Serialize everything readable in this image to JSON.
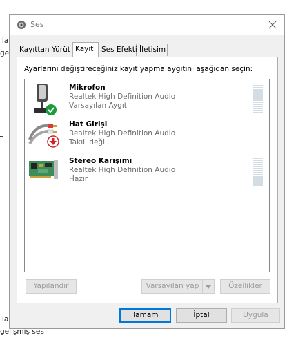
{
  "background": {
    "left_fragment_1": "lla",
    "left_fragment_2": "ge",
    "left_fragment_3": "lla",
    "left_fragment_4": "gelişmiş ses"
  },
  "window": {
    "title": "Ses",
    "icon": "speaker-icon",
    "close_icon": "close-icon"
  },
  "tabs": [
    {
      "label": "Kayıttan Yürüt",
      "active": false
    },
    {
      "label": "Kayıt",
      "active": true
    },
    {
      "label": "Ses Efekti",
      "active": false
    },
    {
      "label": "İletişim",
      "active": false
    }
  ],
  "instruction": "Ayarlarını değiştireceğiniz kayıt yapma aygıtını aşağıdan seçin:",
  "devices": [
    {
      "name": "Mikrofon",
      "driver": "Realtek High Definition Audio",
      "status": "Varsayılan Aygıt",
      "icon": "microphone-icon",
      "badge": "check-icon",
      "level": 0
    },
    {
      "name": "Hat Girişi",
      "driver": "Realtek High Definition Audio",
      "status": "Takılı değil",
      "icon": "audio-cable-icon",
      "badge": "unplugged-arrow-icon",
      "level": null
    },
    {
      "name": "Stereo Karışımı",
      "driver": "Realtek High Definition Audio",
      "status": "Hazır",
      "icon": "circuit-board-icon",
      "badge": null,
      "level": 0
    }
  ],
  "buttons": {
    "configure": "Yapılandır",
    "set_default": "Varsayılan yap",
    "properties": "Özellikler",
    "ok": "Tamam",
    "cancel": "İptal",
    "apply": "Uygula"
  },
  "colors": {
    "dialog_bg": "#f0f0f0",
    "accent": "#0078d7",
    "meter": "#d4dde4",
    "check_badge": "#1a9c3a",
    "unplugged_badge": "#d1202a"
  }
}
